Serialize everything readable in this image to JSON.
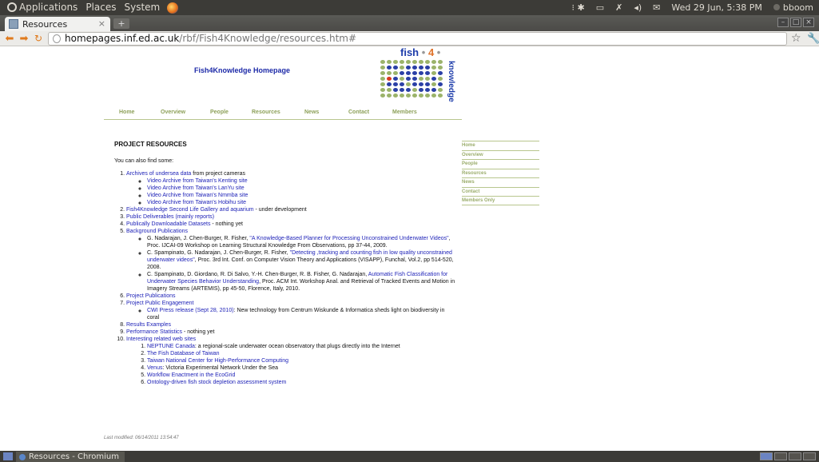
{
  "panel": {
    "menus": [
      "Applications",
      "Places",
      "System"
    ],
    "clock": "Wed 29 Jun,  5:38 PM",
    "user": "bboom"
  },
  "browser": {
    "tab_title": "Resources",
    "tab_close": "×",
    "new_tab": "+",
    "url_host": "homepages.inf.ed.ac.uk",
    "url_path": "/rbf/Fish4Knowledge/resources.htm#"
  },
  "site": {
    "title": "Fish4Knowledge Homepage",
    "logo": {
      "fish": "fish",
      "four": "4",
      "knowledge": "knowledge",
      "bullet": "•"
    },
    "nav": [
      "Home",
      "Overview",
      "People",
      "Resources",
      "News",
      "Contact",
      "Members"
    ],
    "sidenav": [
      "Home",
      "Overview",
      "People",
      "Resources",
      "News",
      "Contact",
      "Members Only"
    ],
    "last_modified": "Last modified: 06/14/2011 13:54:47"
  },
  "content": {
    "heading": "PROJECT RESOURCES",
    "intro": "You can also find some:",
    "items": {
      "i1": {
        "link": "Archives of undersea data",
        "rest": " from project cameras",
        "sub": [
          "Video Archive from Taiwan's Kenting site",
          "Video Archive from Taiwan's LanYu site",
          "Video Archive from Taiwan's Nmmba site",
          "Video Archive from Taiwan's Hobihu site"
        ]
      },
      "i2": {
        "link": "Fish4Knowledge Second Life Gallery and aquarium",
        "rest": " - under development"
      },
      "i3": {
        "link": "Public Deliverables (mainly reports)"
      },
      "i4": {
        "link": "Publically Downloadable Datasets",
        "rest": " - nothing yet"
      },
      "i5": {
        "link": "Background Publications",
        "pubs": [
          {
            "pre": "G. Nadarajan, J. Chen-Burger, R. Fisher, ",
            "link": "\"A Knowledge-Based Planner for Processing Unconstrained Underwater Videos\"",
            "post": ", Proc. IJCAI-09 Workshop on Learning Structural Knowledge From Observations, pp 37-44, 2009."
          },
          {
            "pre": "C. Spampinato, G. Nadarajan, J. Chen-Burger, R. Fisher, ",
            "link": "\"Detecting ,tracking and counting fish in low quality unconstrained underwater videos\"",
            "post": ", Proc. 3rd Int. Conf. on Computer Vision Theory and Applications (VISAPP), Funchal, Vol.2, pp 514-520, 2008."
          },
          {
            "pre": "C. Spampinato, D. Giordano, R. Di Salvo, Y.-H. Chen-Burger, R. B. Fisher, G. Nadarajan, ",
            "link": "Automatic Fish Classification for Underwater Species Behavior Understanding",
            "post": ", Proc. ACM Int. Workshop Anal. and Retrieval of Tracked Events and Motion in Imagery Streams (ARTEMIS), pp 45-50, Florence, Italy, 2010."
          }
        ]
      },
      "i6": {
        "link": "Project Publications"
      },
      "i7": {
        "link": "Project Public Engagement",
        "sub_link": "CWI Press release (Sept 28, 2010)",
        "sub_rest": ": New technology from Centrum Wiskunde & Informatica sheds light on biodiversity in coral"
      },
      "i8": {
        "link": "Results Examples"
      },
      "i9": {
        "link": "Performance Statistics",
        "rest": " - nothing yet"
      },
      "i10": {
        "link": "Interesting related web sites",
        "sites": [
          {
            "link": "NEPTUNE Canada",
            "rest": ": a regional-scale underwater ocean observatory that plugs directly into the Internet"
          },
          {
            "link": "The Fish Database of Taiwan",
            "rest": ""
          },
          {
            "link": "Taiwan National Center for High-Performance Computing",
            "rest": ""
          },
          {
            "link": "Venus",
            "rest": ": Victoria Experimental Network Under the Sea"
          },
          {
            "link": "Workflow Enactment in the EcoGrid",
            "rest": ""
          },
          {
            "link": "Ontology-driven fish stock depletion assessment system",
            "rest": ""
          }
        ]
      }
    }
  },
  "taskbar": {
    "task": "Resources - Chromium"
  }
}
